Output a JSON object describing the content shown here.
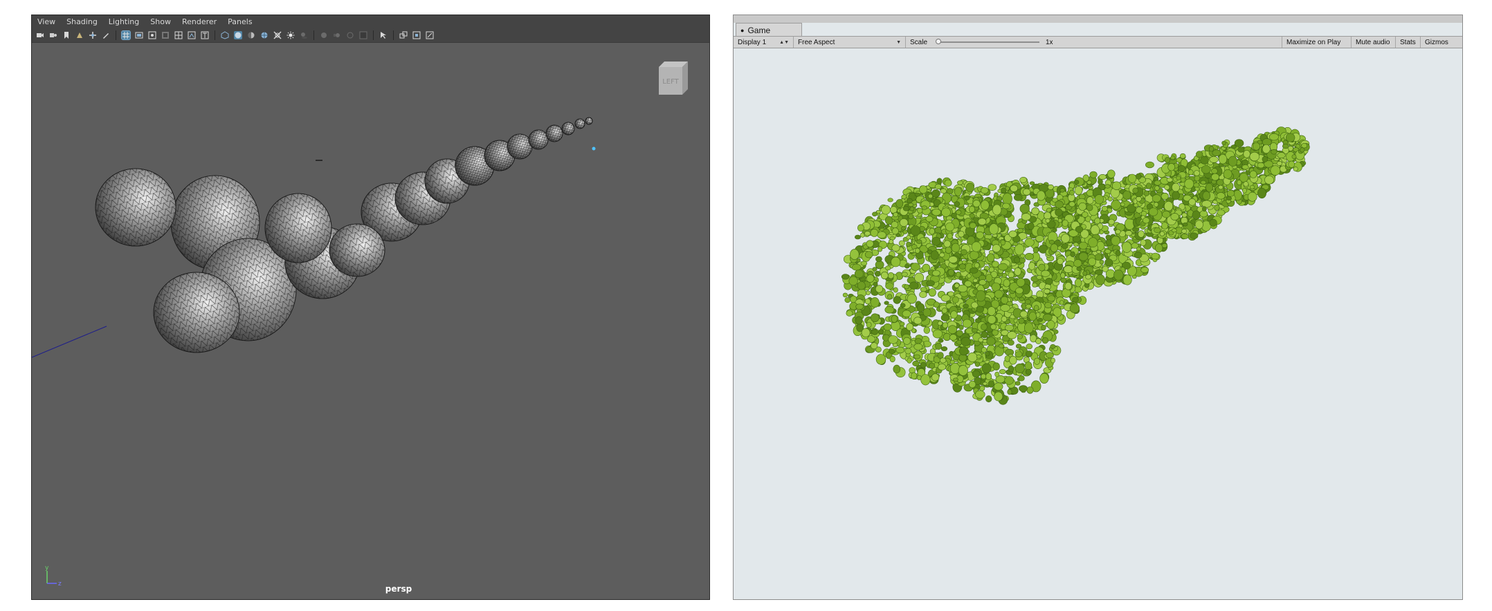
{
  "maya": {
    "menu": [
      "View",
      "Shading",
      "Lighting",
      "Show",
      "Renderer",
      "Panels"
    ],
    "viewcube_label": "LEFT",
    "camera_label": "persp",
    "axis": {
      "y": "y",
      "z": "z"
    },
    "toolbar_icons": [
      "camera-icon",
      "camera-attributes-icon",
      "bookmark-icon",
      "image-plane-icon",
      "2d-pan-zoom-icon",
      "grease-pencil-icon",
      "grid-icon",
      "film-gate-icon",
      "resolution-gate-icon",
      "gate-mask-icon",
      "field-chart-icon",
      "safe-action-icon",
      "safe-title-icon",
      "wireframe-icon",
      "smooth-shade-all-icon",
      "use-default-material-icon",
      "wireframe-on-shaded-icon",
      "xray-icon",
      "use-all-lights-icon",
      "shadows-icon",
      "ambient-occlusion-icon",
      "motion-blur-icon",
      "multisample-aa-icon",
      "depth-of-field-icon",
      "hud-icon",
      "isolate-select-icon",
      "xray-joints-icon",
      "xray-active-components-icon"
    ],
    "colors": {
      "viewport_bg": "#5d5d5d",
      "menubar_bg": "#444444",
      "accent": "#5285a6"
    }
  },
  "unity": {
    "tab_label": "Game",
    "display": "Display 1",
    "aspect": "Free Aspect",
    "scale_label": "Scale",
    "scale_value": "1x",
    "scale_slider_fraction": 0.0,
    "buttons": [
      "Maximize on Play",
      "Mute audio",
      "Stats",
      "Gizmos"
    ],
    "colors": {
      "game_bg": "#e2e8eb",
      "foliage": "#7fae2a",
      "foliage_dark": "#3f6612"
    }
  }
}
